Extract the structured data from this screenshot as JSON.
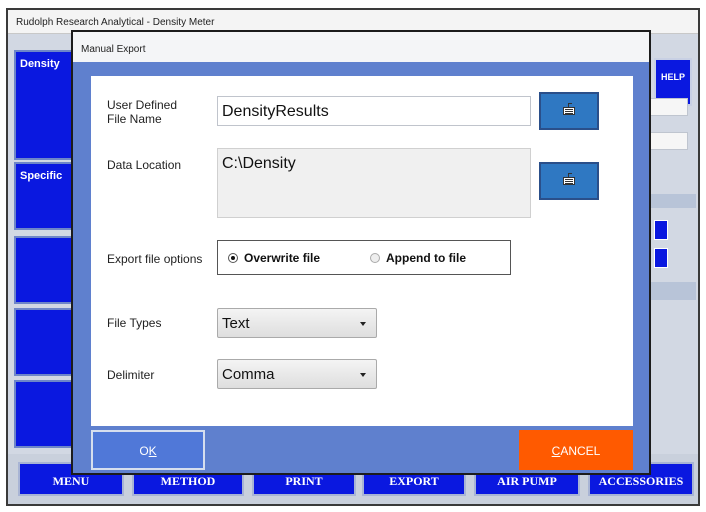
{
  "main_window": {
    "title": "Rudolph Research Analytical - Density Meter",
    "sidebar": [
      "Density",
      "Specific"
    ],
    "help_tab": "HELP",
    "bottom_buttons": [
      "MENU",
      "METHOD",
      "PRINT",
      "EXPORT",
      "AIR PUMP",
      "ACCESSORIES"
    ]
  },
  "dialog": {
    "title": "Manual Export",
    "file_name": {
      "label_line1": "User Defined",
      "label_line2": "File Name",
      "value": "DensityResults",
      "keyboard_icon": "keyboard-icon"
    },
    "data_location": {
      "label": "Data Location",
      "value": "C:\\Density",
      "keyboard_icon": "keyboard-icon"
    },
    "export_options": {
      "label": "Export file options",
      "options": [
        {
          "label": "Overwrite file",
          "selected": true
        },
        {
          "label": "Append to file",
          "selected": false
        }
      ]
    },
    "file_types": {
      "label": "File Types",
      "selected": "Text"
    },
    "delimiter": {
      "label": "Delimiter",
      "selected": "Comma"
    },
    "ok_button": {
      "hotkey": "K",
      "prefix": "O",
      "label": "OK"
    },
    "cancel_button": {
      "hotkey": "C",
      "rest": "ANCEL",
      "label": "CANCEL"
    }
  },
  "colors": {
    "accent_blue": "#0a18e0",
    "dialog_frame": "#5f80ce",
    "ok": "#5078d8",
    "cancel": "#ff5a00",
    "keyboard_button": "#2f78c2"
  }
}
